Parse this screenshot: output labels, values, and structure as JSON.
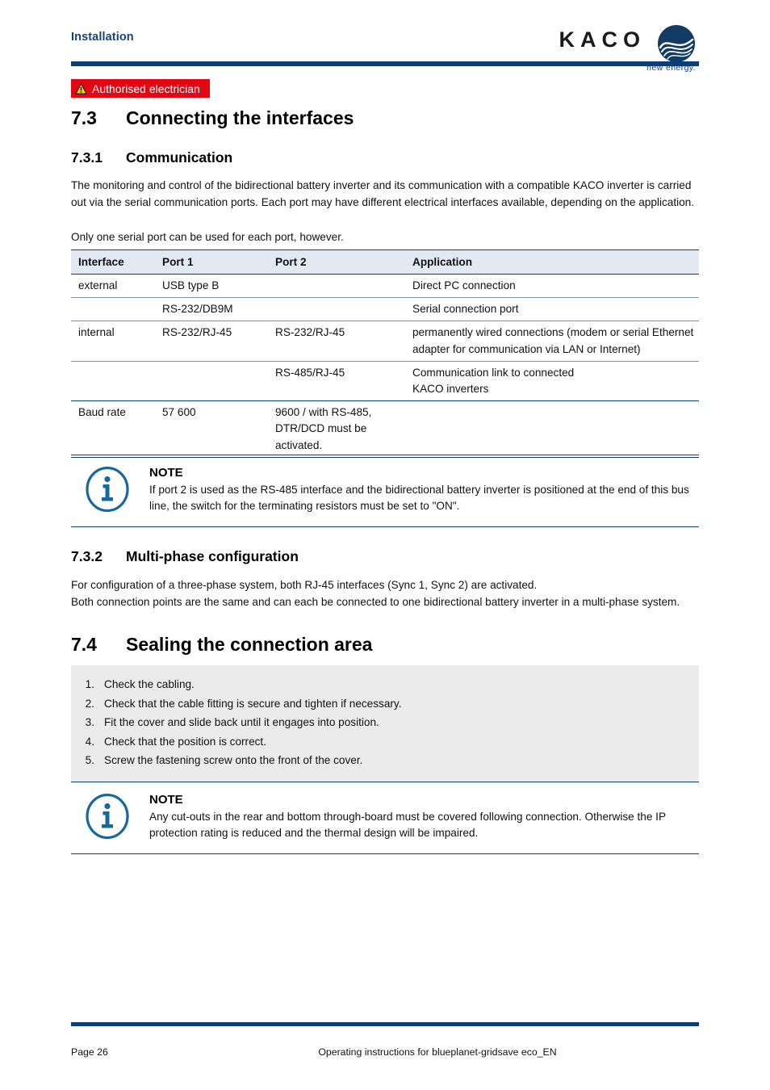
{
  "header": {
    "section_label": "Installation",
    "logo_word": "KACO",
    "logo_tagline": "new energy.",
    "logo_mark_name": "kaco-globe-logo"
  },
  "badge": {
    "label": "Authorised electrician",
    "icon": "warning-triangle-icon",
    "bg_color": "#e30613",
    "text_color": "#ffffff"
  },
  "sections": {
    "s73_num": "7.3",
    "s73_title": "Connecting the interfaces",
    "s731_num": "7.3.1",
    "s731_title": "Communication",
    "s732_num": "7.3.2",
    "s732_title": "Multi-phase configuration",
    "s74_num": "7.4",
    "s74_title": "Sealing the connection area"
  },
  "paragraphs": {
    "comm_intro": "The monitoring and control of the bidirectional battery inverter and its communication with a compatible KACO inverter is carried out via the serial communication ports.  Each port may have different electrical interfaces available, depending on the application.",
    "comm_second": "Only one serial port can be used for each port, however.",
    "multiphase": "For configuration of a three-phase system, both RJ-45 interfaces (Sync 1, Sync 2) are activated.\nBoth connection points are the same and can each be connected to one bidirectional battery inverter in a multi-phase system."
  },
  "table": {
    "headers": [
      "Interface",
      "Port 1",
      "Port 2",
      "Application"
    ],
    "rows": [
      {
        "separator": "none",
        "cells": [
          "external",
          "USB type B",
          "",
          "Direct PC connection"
        ]
      },
      {
        "separator": "thin",
        "cells": [
          "",
          "RS-232/DB9M",
          "",
          "Serial connection port"
        ]
      },
      {
        "separator": "thin",
        "cells": [
          "internal",
          "RS-232/RJ-45",
          "RS-232/RJ-45",
          "permanently wired connections (modem or serial Ethernet adapter for communication via LAN or Internet)"
        ]
      },
      {
        "separator": "thin",
        "cells": [
          "",
          "",
          "RS-485/RJ-45",
          "Communication link to connected\nKACO inverters"
        ]
      },
      {
        "separator": "thick",
        "cells": [
          "Baud rate",
          "57 600",
          "9600 / with RS-485, DTR/DCD must be activated.",
          ""
        ]
      }
    ]
  },
  "note1": {
    "icon": "info-circle-icon",
    "title": "NOTE",
    "body": "If port 2 is used as the RS-485 interface and the bidirectional battery inverter is positioned at the end of this bus line, the switch for the terminating resistors must be set to \"ON\"."
  },
  "note2": {
    "icon": "info-circle-icon",
    "title": "NOTE",
    "body": "Any cut-outs in the rear and bottom through-board must be covered following connection. Otherwise the IP protection rating is reduced and the thermal design will be impaired."
  },
  "steps": {
    "items": [
      {
        "num": "1.",
        "text": "Check the cabling."
      },
      {
        "num": "2.",
        "text": "Check that the cable fitting is secure and tighten if necessary."
      },
      {
        "num": "3.",
        "text": "Fit the cover and slide back until it engages into position."
      },
      {
        "num": "4.",
        "text": "Check that the position is correct."
      },
      {
        "num": "5.",
        "text": "Screw the fastening screw onto the front of the cover."
      }
    ]
  },
  "footer": {
    "page_label": "Page 26",
    "document_title": "Operating instructions for blueplanet-gridsave eco_EN"
  },
  "colors": {
    "brand_navy": "#0b3d7a",
    "heading_blue": "#14427e",
    "warning_red": "#e30613",
    "table_header_bg": "#e3e9f2",
    "steps_bg": "#ebebeb"
  }
}
